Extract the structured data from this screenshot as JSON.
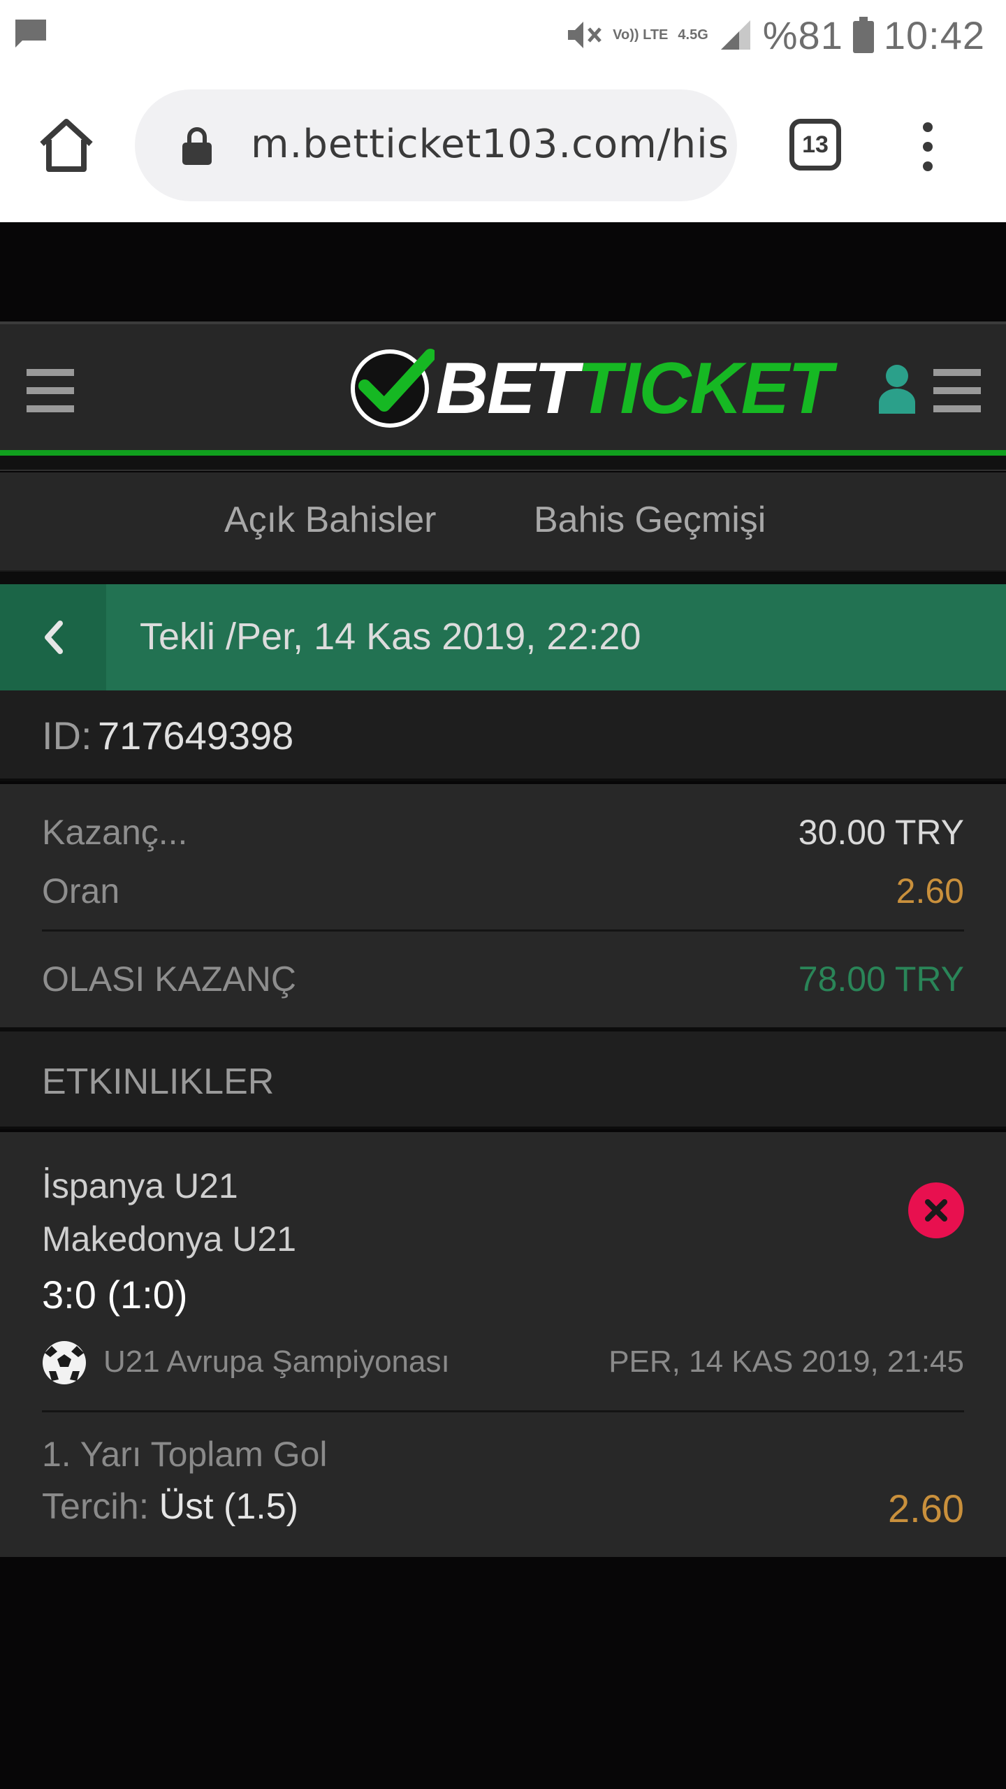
{
  "status_bar": {
    "network_label_1": "Vo)) LTE",
    "network_label_2": "4.5G",
    "battery": "%81",
    "time": "10:42"
  },
  "browser": {
    "url": "m.betticket103.com/his",
    "tab_count": "13"
  },
  "header": {
    "logo_part1": "BET",
    "logo_part2": "TICKET",
    "brand_green": "#11a01e"
  },
  "tabs": {
    "open_bets": "Açık Bahisler",
    "history": "Bahis Geçmişi"
  },
  "bet": {
    "title": "Tekli /Per, 14 Kas 2019, 22:20",
    "id_label": "ID:",
    "id_value": "717649398",
    "stake_label": "Kazanç...",
    "stake_value": "30.00 TRY",
    "odds_label": "Oran",
    "odds_value": "2.60",
    "payout_label": "OLASI KAZANÇ",
    "payout_value": "78.00 TRY"
  },
  "events": {
    "title": "ETKINLIKLER",
    "items": [
      {
        "home": "İspanya U21",
        "away": "Makedonya U21",
        "score": "3:0 (1:0)",
        "league": "U21 Avrupa Şampiyonası",
        "date": "PER, 14 KAS 2019, 21:45",
        "market": "1. Yarı Toplam Gol",
        "pick_label": "Tercih:",
        "pick_value": "Üst (1.5)",
        "odds": "2.60",
        "status": "lost"
      }
    ]
  },
  "colors": {
    "accent_green": "#227252",
    "odds_gold": "#c9903c",
    "payout_green": "#2a8558",
    "remove_red": "#e8104f"
  }
}
